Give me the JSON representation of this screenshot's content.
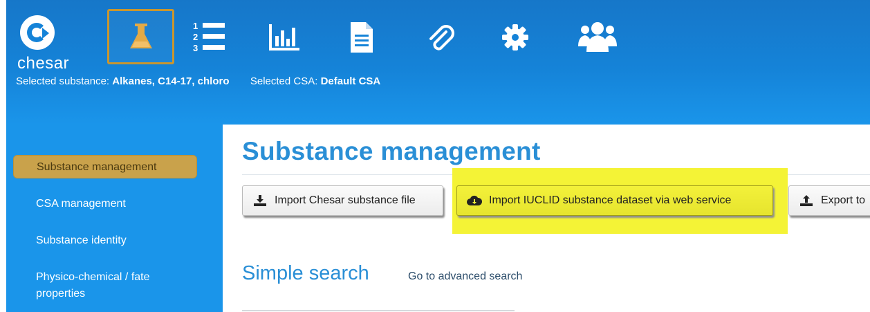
{
  "app": {
    "logo_text": "chesar",
    "selected_substance_label": "Selected substance:",
    "selected_substance_value": "Alkanes, C14-17, chloro",
    "selected_csa_label": "Selected CSA:",
    "selected_csa_value": "Default CSA"
  },
  "nav": {
    "icons": [
      "flask-icon",
      "numbered-list-icon",
      "bar-chart-icon",
      "document-icon",
      "paperclip-icon",
      "gear-icon",
      "users-icon"
    ],
    "active": "flask-icon"
  },
  "sidebar": {
    "items": [
      {
        "label": "Substance management",
        "active": true
      },
      {
        "label": "CSA management",
        "active": false
      },
      {
        "label": "Substance identity",
        "active": false
      },
      {
        "label": "Physico-chemical / fate properties",
        "active": false
      }
    ]
  },
  "main": {
    "title": "Substance management",
    "buttons": {
      "import_chesar": "Import Chesar substance file",
      "import_iuclid": "Import IUCLID substance dataset via web service",
      "export": "Export to"
    },
    "search_title": "Simple search",
    "advanced_link": "Go to advanced search"
  },
  "colors": {
    "header_blue": "#1583d8",
    "accent_gold": "#c9a24b",
    "title_blue": "#2a8fd6",
    "highlight_yellow": "#f4f336"
  }
}
